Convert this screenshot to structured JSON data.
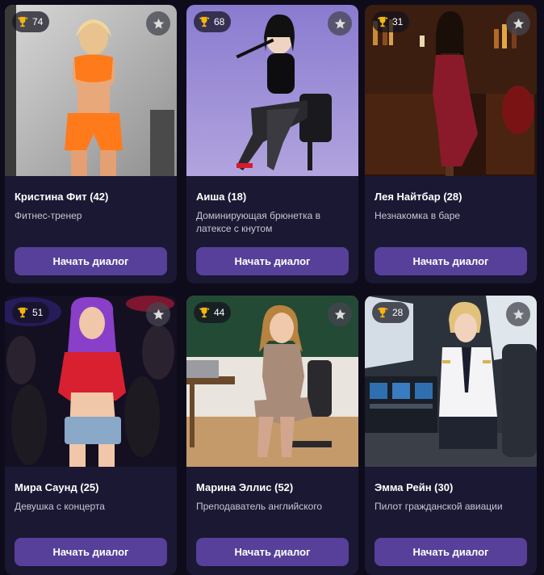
{
  "cards": [
    {
      "rating": "74",
      "name": "Кристина Фит (42)",
      "description": "Фитнес-тренер",
      "button": "Начать диалог"
    },
    {
      "rating": "68",
      "name": "Аиша (18)",
      "description": "Доминирующая брюнетка в латексе с кнутом",
      "button": "Начать диалог"
    },
    {
      "rating": "31",
      "name": "Лея Найтбар (28)",
      "description": "Незнакомка в баре",
      "button": "Начать диалог"
    },
    {
      "rating": "51",
      "name": "Мира Саунд (25)",
      "description": "Девушка с концерта",
      "button": "Начать диалог"
    },
    {
      "rating": "44",
      "name": "Марина Эллис (52)",
      "description": "Преподаватель английского",
      "button": "Начать диалог"
    },
    {
      "rating": "28",
      "name": "Эмма Рейн (30)",
      "description": "Пилот гражданской авиации",
      "button": "Начать диалог"
    }
  ],
  "icons": {
    "rating": "trophy-icon",
    "favorite": "star-icon"
  },
  "colors": {
    "background": "#0e0c1a",
    "card": "#1b1833",
    "button": "#56409a",
    "trophy": "#f5b40f"
  }
}
